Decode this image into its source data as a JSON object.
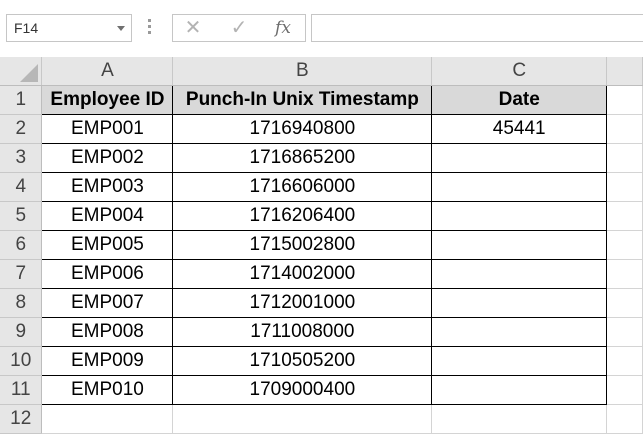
{
  "name_box": {
    "value": "F14"
  },
  "formula_bar": {
    "cancel_icon": "✕",
    "enter_icon": "✓",
    "fx_label": "fx",
    "content": ""
  },
  "columns": [
    "A",
    "B",
    "C"
  ],
  "rows": [
    "1",
    "2",
    "3",
    "4",
    "5",
    "6",
    "7",
    "8",
    "9",
    "10",
    "11",
    "12"
  ],
  "table": {
    "headers": [
      "Employee ID",
      "Punch-In Unix Timestamp",
      "Date"
    ],
    "rows": [
      [
        "EMP001",
        "1716940800",
        "45441"
      ],
      [
        "EMP002",
        "1716865200",
        ""
      ],
      [
        "EMP003",
        "1716606000",
        ""
      ],
      [
        "EMP004",
        "1716206400",
        ""
      ],
      [
        "EMP005",
        "1715002800",
        ""
      ],
      [
        "EMP006",
        "1714002000",
        ""
      ],
      [
        "EMP007",
        "1712001000",
        ""
      ],
      [
        "EMP008",
        "1711008000",
        ""
      ],
      [
        "EMP009",
        "1710505200",
        ""
      ],
      [
        "EMP010",
        "1709000400",
        ""
      ]
    ]
  }
}
